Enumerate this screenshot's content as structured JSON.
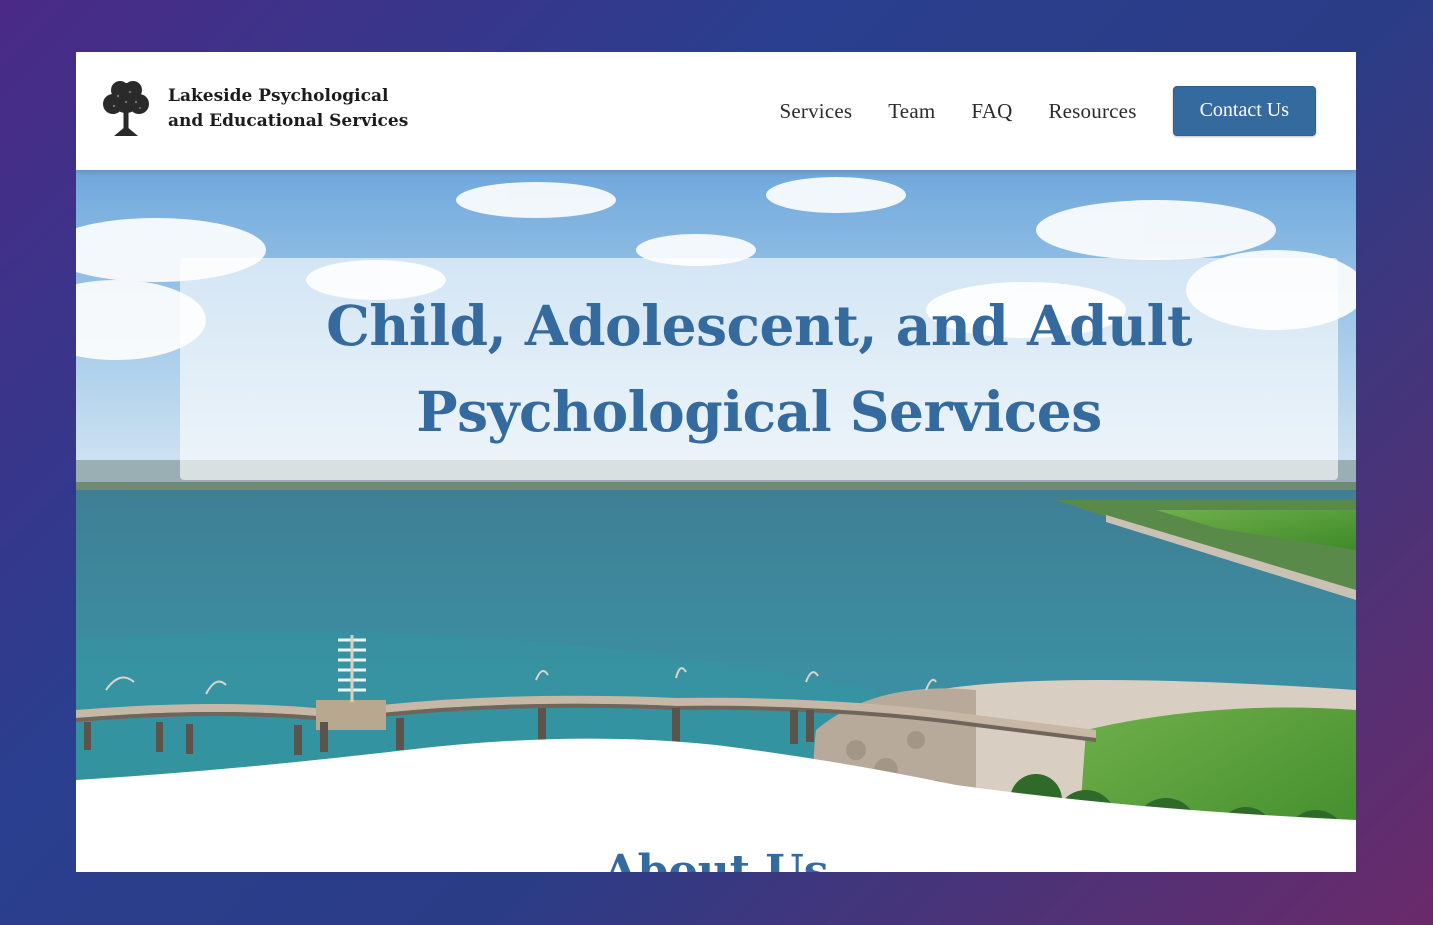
{
  "brand": {
    "name_line1": "Lakeside Psychological",
    "name_line2": "and Educational Services",
    "logo_icon": "tree-icon"
  },
  "nav": {
    "items": [
      "Services",
      "Team",
      "FAQ",
      "Resources"
    ],
    "contact_label": "Contact Us"
  },
  "hero": {
    "headline_line1": "Child, Adolescent, and Adult",
    "headline_line2": "Psychological Services",
    "image": "lakeside-pier-image"
  },
  "about": {
    "heading": "About Us"
  },
  "colors": {
    "accent": "#356a9e",
    "button_text": "#ffffff",
    "water": "#3f8fa3",
    "sky": "#9cc7e8"
  }
}
